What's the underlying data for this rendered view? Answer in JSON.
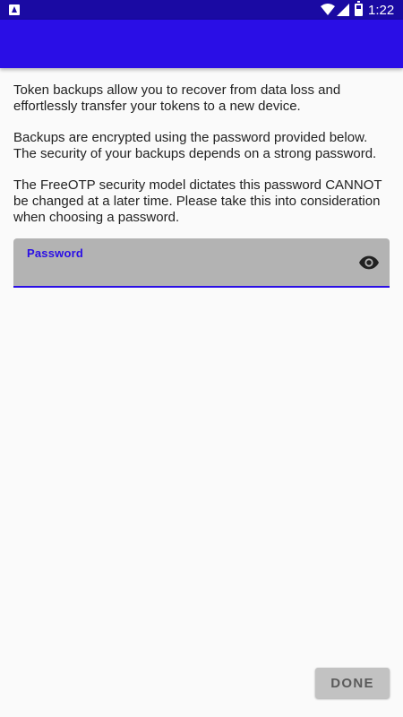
{
  "status_bar": {
    "time": "1:22",
    "icons": [
      "app-notification-icon",
      "wifi-icon",
      "cell-signal-icon",
      "battery-icon"
    ]
  },
  "app_bar": {
    "color": "#2a0ee6"
  },
  "content": {
    "paragraph_1": "Token backups allow you to recover from data loss and effortlessly transfer your tokens to a new device.",
    "paragraph_2": "Backups are encrypted using the password provided below. The security of your backups depends on a strong password.",
    "paragraph_3": "The FreeOTP security model dictates this password CANNOT be changed at a later time. Please take this into consideration when choosing a password."
  },
  "password_field": {
    "label": "Password",
    "value": "",
    "toggle_icon": "eye-icon"
  },
  "actions": {
    "done_label": "DONE"
  },
  "colors": {
    "status_bar": "#1a0aa3",
    "accent": "#2a0ee6",
    "field_background": "#b3b3b3",
    "button_background": "#c2c2c2"
  }
}
